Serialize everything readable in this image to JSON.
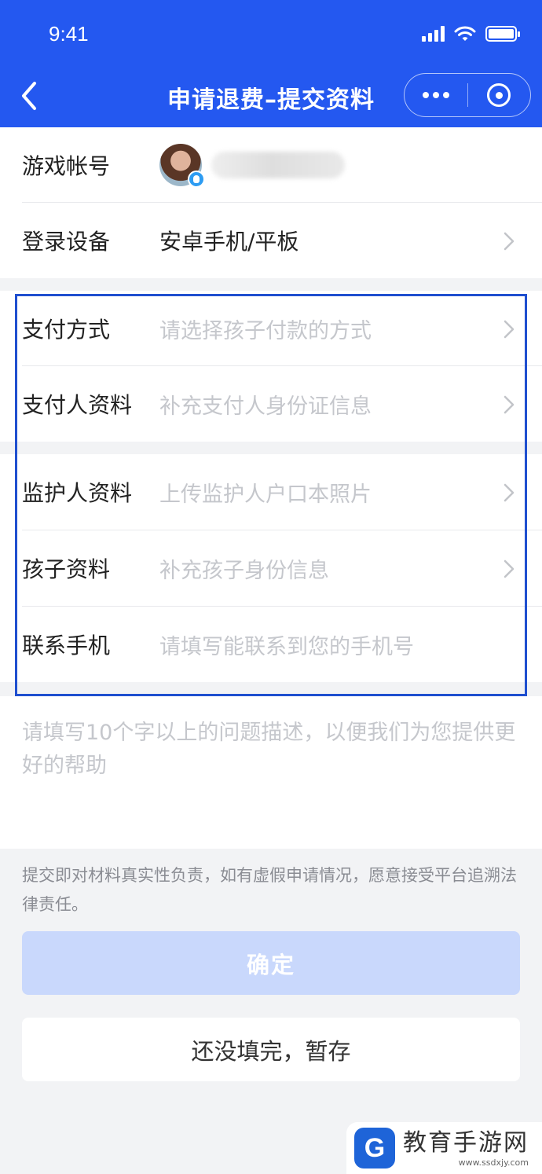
{
  "status_bar": {
    "time": "9:41"
  },
  "nav": {
    "title": "申请退费–提交资料"
  },
  "account_section": {
    "game_account_label": "游戏帐号",
    "device_label": "登录设备",
    "device_value": "安卓手机/平板"
  },
  "form_rows": [
    {
      "label": "支付方式",
      "placeholder": "请选择孩子付款的方式"
    },
    {
      "label": "支付人资料",
      "placeholder": "补充支付人身份证信息"
    },
    {
      "label": "监护人资料",
      "placeholder": "上传监护人户口本照片"
    },
    {
      "label": "孩子资料",
      "placeholder": "补充孩子身份信息"
    },
    {
      "label": "联系手机",
      "placeholder": "请填写能联系到您的手机号"
    }
  ],
  "description": {
    "placeholder": "请填写10个字以上的问题描述，以便我们为您提供更好的帮助"
  },
  "notice": "提交即对材料真实性负责，如有虚假申请情况，愿意接受平台追溯法律责任。",
  "buttons": {
    "confirm": "确定",
    "save_draft": "还没填完，暂存"
  },
  "watermark": {
    "logo_letter": "G",
    "title": "教育手游网",
    "url": "www.ssdxjy.com"
  },
  "colors": {
    "nav_blue": "#2458f0",
    "highlight_border": "#1f4fcf",
    "confirm_disabled": "#c9d8fc"
  }
}
